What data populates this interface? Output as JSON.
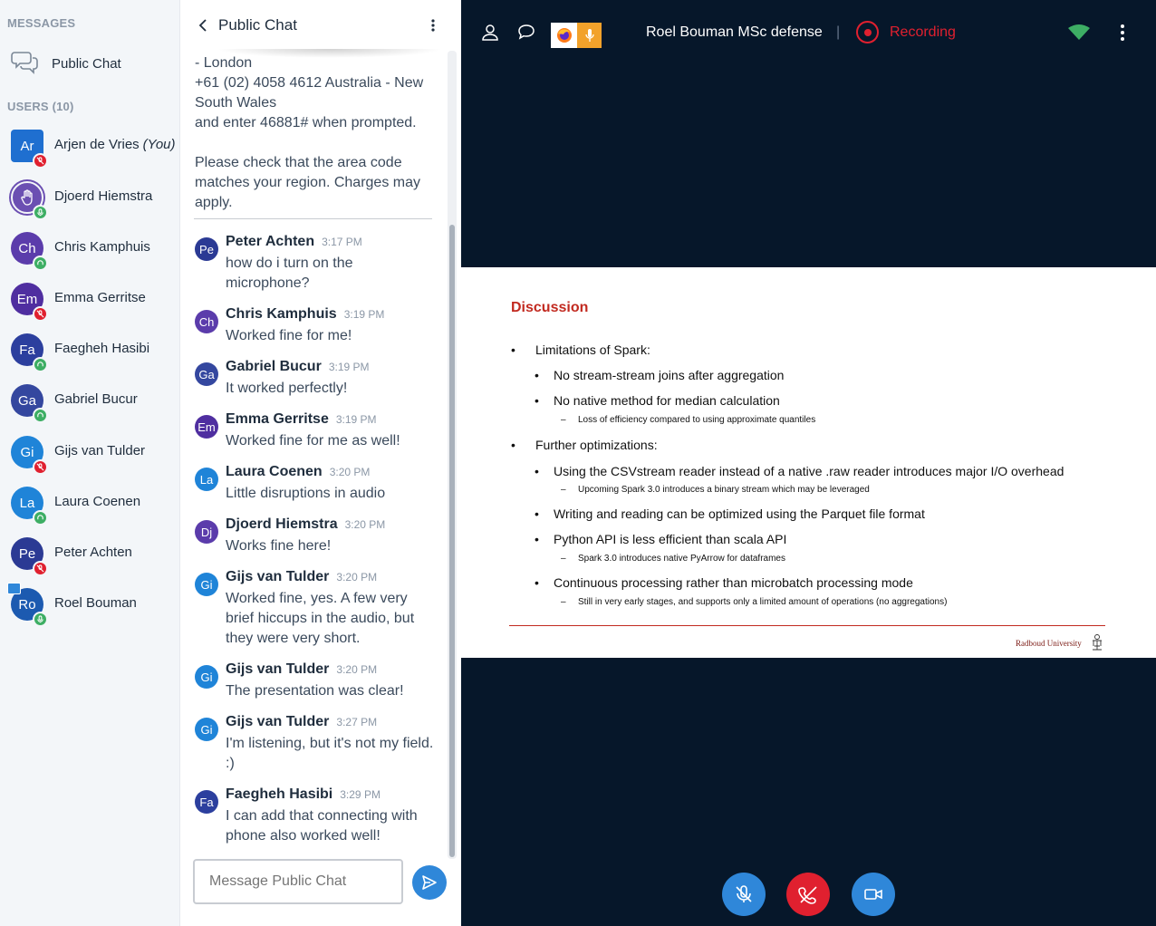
{
  "sidebar": {
    "messages_label": "MESSAGES",
    "public_chat_label": "Public Chat",
    "users_label": "USERS (10)",
    "users": [
      {
        "initials": "Ar",
        "name": "Arjen de Vries",
        "you": "(You)",
        "color": "#1f6fd0",
        "status": "muted"
      },
      {
        "initials": "",
        "name": "Djoerd Hiemstra",
        "you": "",
        "color": "#6b4fb2",
        "status": "mic",
        "raised_hand": true
      },
      {
        "initials": "Ch",
        "name": "Chris Kamphuis",
        "you": "",
        "color": "#5b3cab",
        "status": "listen"
      },
      {
        "initials": "Em",
        "name": "Emma Gerritse",
        "you": "",
        "color": "#4f2ea0",
        "status": "muted"
      },
      {
        "initials": "Fa",
        "name": "Faegheh Hasibi",
        "you": "",
        "color": "#2c3f9e",
        "status": "listen"
      },
      {
        "initials": "Ga",
        "name": "Gabriel Bucur",
        "you": "",
        "color": "#34479f",
        "status": "listen"
      },
      {
        "initials": "Gi",
        "name": "Gijs van Tulder",
        "you": "",
        "color": "#1f84d8",
        "status": "muted"
      },
      {
        "initials": "La",
        "name": "Laura Coenen",
        "you": "",
        "color": "#1f84d8",
        "status": "listen"
      },
      {
        "initials": "Pe",
        "name": "Peter Achten",
        "you": "",
        "color": "#2b3a94",
        "status": "muted"
      },
      {
        "initials": "Ro",
        "name": "Roel Bouman",
        "you": "",
        "color": "#1c5ab0",
        "status": "mic",
        "presenter": true
      }
    ]
  },
  "chat": {
    "title": "Public Chat",
    "welcome_lines": [
      "- London",
      "+61 (02) 4058 4612 Australia - New South Wales",
      "and enter 46881# when prompted.",
      "",
      "Please check that the area code matches your region. Charges may apply."
    ],
    "messages": [
      {
        "initials": "Pe",
        "color": "#2b3a94",
        "sender": "Peter Achten",
        "time": "3:17 PM",
        "text": "how do i turn on the microphone?"
      },
      {
        "initials": "Ch",
        "color": "#5b3cab",
        "sender": "Chris Kamphuis",
        "time": "3:19 PM",
        "text": "Worked fine for me!"
      },
      {
        "initials": "Ga",
        "color": "#34479f",
        "sender": "Gabriel Bucur",
        "time": "3:19 PM",
        "text": "It worked perfectly!"
      },
      {
        "initials": "Em",
        "color": "#4f2ea0",
        "sender": "Emma Gerritse",
        "time": "3:19 PM",
        "text": "Worked fine for me as well!"
      },
      {
        "initials": "La",
        "color": "#1f84d8",
        "sender": "Laura Coenen",
        "time": "3:20 PM",
        "text": "Little disruptions in audio"
      },
      {
        "initials": "Dj",
        "color": "#5b3cab",
        "sender": "Djoerd Hiemstra",
        "time": "3:20 PM",
        "text": "Works fine here!"
      },
      {
        "initials": "Gi",
        "color": "#1f84d8",
        "sender": "Gijs van Tulder",
        "time": "3:20 PM",
        "text": "Worked fine, yes. A few very brief hiccups in the audio, but they were very short."
      },
      {
        "initials": "Gi",
        "color": "#1f84d8",
        "sender": "Gijs van Tulder",
        "time": "3:20 PM",
        "text": "The presentation was clear!"
      },
      {
        "initials": "Gi",
        "color": "#1f84d8",
        "sender": "Gijs van Tulder",
        "time": "3:27 PM",
        "text": "I'm listening, but it's not my field. :)"
      },
      {
        "initials": "Fa",
        "color": "#2c3f9e",
        "sender": "Faegheh Hasibi",
        "time": "3:29 PM",
        "text": "I can add that connecting with phone also worked well!"
      }
    ],
    "input_placeholder": "Message Public Chat"
  },
  "stage": {
    "meeting_title": "Roel Bouman MSc defense",
    "separator": "|",
    "recording_label": "Recording",
    "colors": {
      "accent": "#2f87d9",
      "danger": "#e0202f",
      "stage_bg": "#06172a",
      "signal": "#3dae64"
    },
    "slide": {
      "title": "Discussion",
      "b1": "Limitations of Spark:",
      "b1a": "No stream-stream joins after aggregation",
      "b1b": "No native method for median calculation",
      "b1b1": "Loss of efficiency compared to using approximate quantiles",
      "b2": "Further optimizations:",
      "b2a": "Using the CSVstream reader instead of a native .raw reader introduces major I/O overhead",
      "b2a1": "Upcoming Spark 3.0 introduces a binary stream which may be leveraged",
      "b2b": "Writing and reading can be optimized using the Parquet file format",
      "b2c": "Python API is less efficient than scala API",
      "b2c1": "Spark 3.0 introduces native PyArrow for dataframes",
      "b2d": "Continuous processing rather than microbatch processing mode",
      "b2d1": "Still in very early stages, and supports only a limited amount of operations (no aggregations)",
      "footer_org": "Radboud University"
    }
  }
}
